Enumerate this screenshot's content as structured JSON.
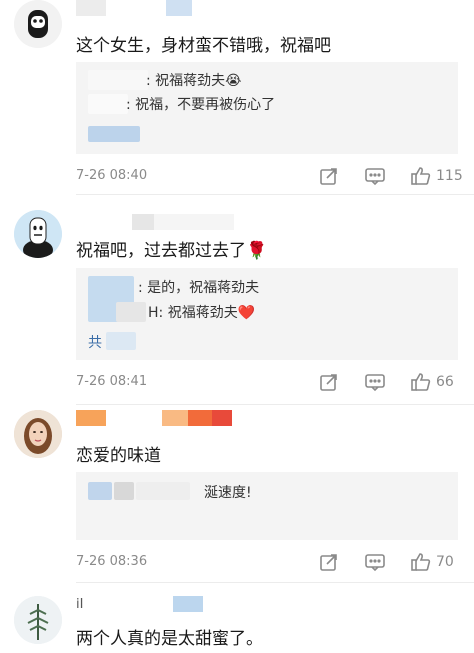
{
  "comments": [
    {
      "content": "这个女生，身材蛮不错哦，祝福吧",
      "emoji": "🌷",
      "replies": [
        {
          "text": ": 祝福蒋劲夫😭"
        },
        {
          "text": ": 祝福，不要再被伤心了"
        }
      ],
      "time": "7-26 08:40",
      "likes": "115"
    },
    {
      "content": "祝福吧，过去都过去了🌹",
      "replies": [
        {
          "text": ": 是的，祝福蒋劲夫"
        },
        {
          "text": "H: 祝福蒋劲夫❤️"
        },
        {
          "text": "共"
        }
      ],
      "time": "7-26 08:41",
      "likes": "66"
    },
    {
      "content": "恋爱的味道",
      "replies": [
        {
          "text": "涎速度!"
        }
      ],
      "time": "7-26 08:36",
      "likes": "70"
    },
    {
      "content": "两个人真的是太甜蜜了。",
      "username_fragment": "iI"
    }
  ],
  "icons": {
    "forward": "forward-icon",
    "comment": "comment-icon",
    "like": "thumbs-up-icon"
  },
  "colors": {
    "reply_bg": "#f4f4f4",
    "meta_text": "#8a8a8a",
    "blur_blue": "#a9c8e8",
    "blur_orange": "#f7a35a",
    "blur_red": "#e84a3a"
  }
}
